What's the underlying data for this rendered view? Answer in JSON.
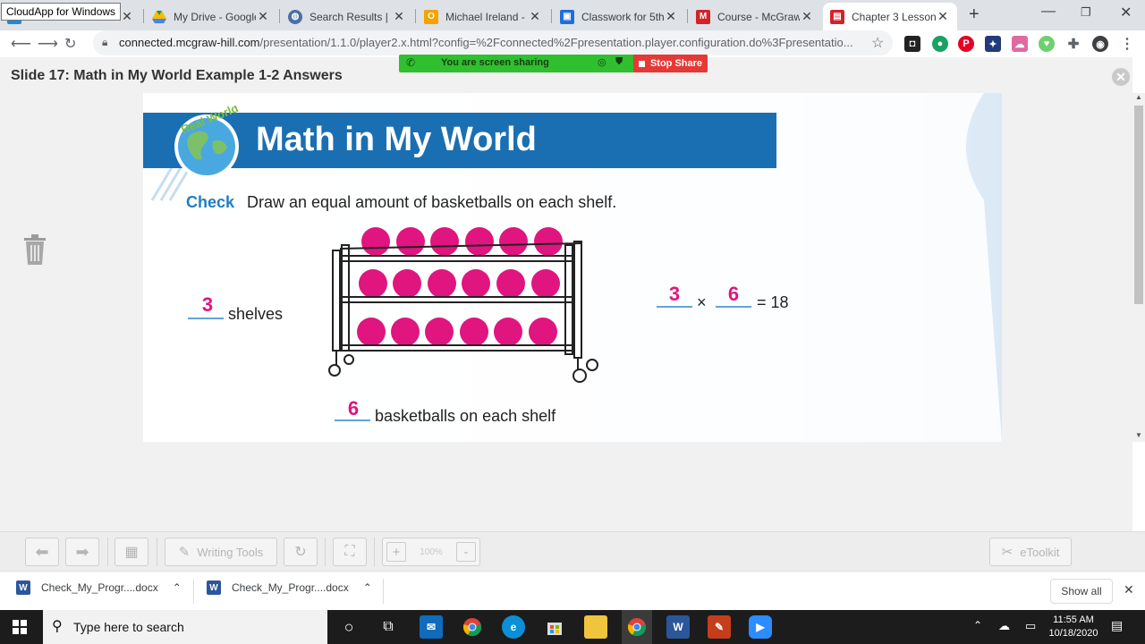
{
  "browser": {
    "tooltip": "CloudApp for Windows",
    "tabs": [
      {
        "title": "",
        "icon": "cloudapp-icon"
      },
      {
        "title": "My Drive - Google",
        "icon": "google-drive-icon"
      },
      {
        "title": "Search Results | D",
        "icon": "globe-icon"
      },
      {
        "title": "Michael Ireland - C",
        "icon": "outlook-icon"
      },
      {
        "title": "Classwork for 5th",
        "icon": "classroom-icon"
      },
      {
        "title": "Course - McGraw-",
        "icon": "mcgraw-icon"
      },
      {
        "title": "Chapter 3 Lesson",
        "icon": "mcgraw-icon",
        "active": true
      }
    ],
    "new_tab": "+",
    "url_host": "connected.mcgraw-hill.com",
    "url_path": "/presentation/1.1.0/player2.x.html?config=%2Fconnected%2Fpresentation.player.configuration.do%3Fpresentatio..."
  },
  "screen_share": {
    "status": "You are screen sharing",
    "stop_label": "Stop Share"
  },
  "slide": {
    "title": "Slide 17: Math in My World Example 1-2 Answers",
    "badge": "Real World",
    "banner": "Math in My World",
    "check_word": "Check",
    "instruction": "Draw an equal amount of basketballs on each shelf.",
    "shelves_answer": "3",
    "shelves_label": "shelves",
    "per_shelf_answer": "6",
    "per_shelf_label": "basketballs on each shelf",
    "eq_factor_1": "3",
    "eq_times": "×",
    "eq_factor_2": "6",
    "eq_result": "= 18"
  },
  "player_toolbar": {
    "writing_tools": "Writing Tools",
    "zoom": "100%",
    "etoolkit": "eToolkit"
  },
  "downloads": {
    "items": [
      "Check_My_Progr....docx",
      "Check_My_Progr....docx"
    ],
    "show_all": "Show all"
  },
  "taskbar": {
    "search_placeholder": "Type here to search",
    "time": "11:55 AM",
    "date": "10/18/2020"
  }
}
